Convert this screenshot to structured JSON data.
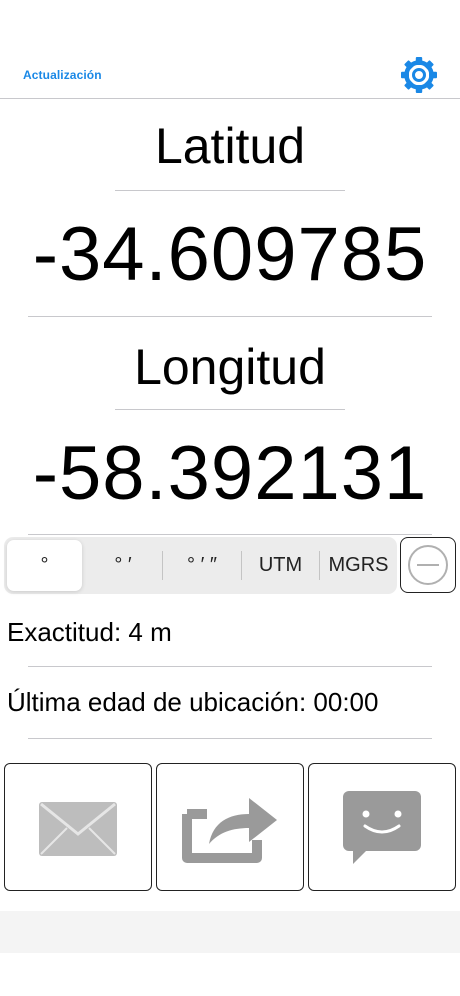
{
  "header": {
    "update_label": "Actualización",
    "settings_icon": "gear-icon",
    "accent_color": "#1a88e6"
  },
  "latitude": {
    "label": "Latitud",
    "value": "-34.609785"
  },
  "longitude": {
    "label": "Longitud",
    "value": "-58.392131"
  },
  "format_selector": {
    "options": [
      "°",
      "° ′",
      "° ′ ″",
      "UTM",
      "MGRS"
    ],
    "selected": "°",
    "toggle_icon": "minus-circle-icon"
  },
  "info": {
    "accuracy": "Exactitud: 4 m",
    "last_age": "Última edad de ubicación: 00:00"
  },
  "share": {
    "icons": [
      "mail-icon",
      "share-icon",
      "message-icon"
    ]
  }
}
